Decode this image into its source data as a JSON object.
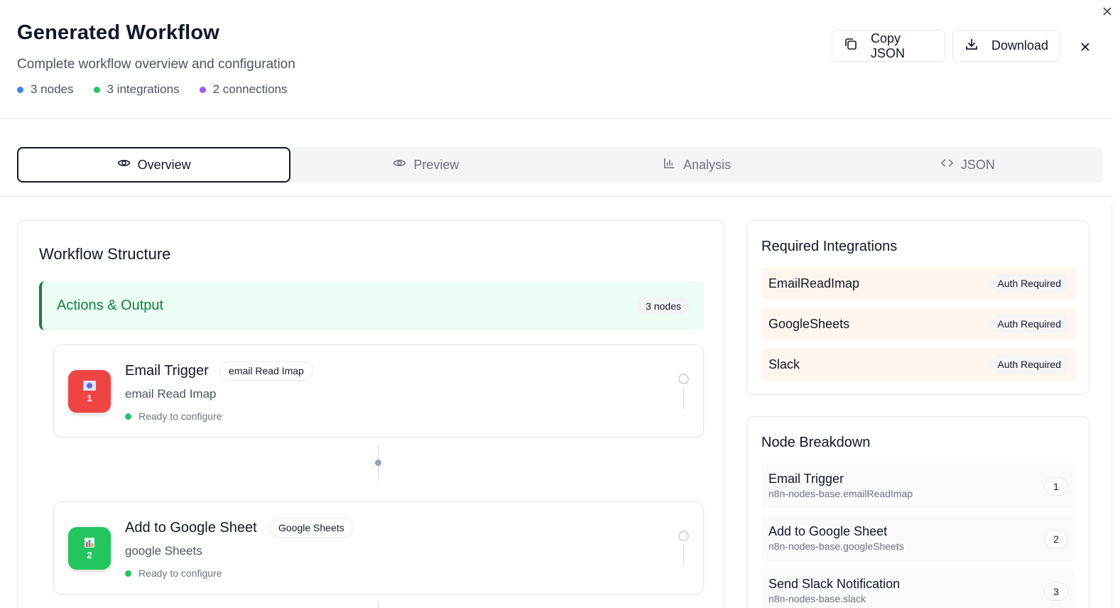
{
  "header": {
    "title": "Generated Workflow",
    "subtitle": "Complete workflow overview and configuration",
    "stats": [
      {
        "label": "3 nodes",
        "color": "#3b82f6"
      },
      {
        "label": "3 integrations",
        "color": "#22c55e"
      },
      {
        "label": "2 connections",
        "color": "#a855f7"
      }
    ],
    "copy_label": "Copy JSON",
    "download_label": "Download"
  },
  "tabs": [
    {
      "label": "Overview",
      "icon": "eye-icon",
      "active": true
    },
    {
      "label": "Preview",
      "icon": "eye-icon",
      "active": false
    },
    {
      "label": "Analysis",
      "icon": "bar-chart-icon",
      "active": false
    },
    {
      "label": "JSON",
      "icon": "code-icon",
      "active": false
    }
  ],
  "workflow": {
    "title": "Workflow Structure",
    "group": {
      "title": "Actions & Output",
      "count": "3 nodes"
    },
    "nodes": [
      {
        "number": "1",
        "title": "Email Trigger",
        "tag": "email Read Imap",
        "subtitle": "email Read Imap",
        "status": "Ready to configure",
        "icon": "email-icon",
        "color": "#ef4444"
      },
      {
        "number": "2",
        "title": "Add to Google Sheet",
        "tag": "Google Sheets",
        "subtitle": "google Sheets",
        "status": "Ready to configure",
        "icon": "sheets-icon",
        "color": "#22c55e"
      }
    ]
  },
  "integrations": {
    "title": "Required Integrations",
    "items": [
      {
        "name": "EmailReadImap",
        "badge": "Auth Required"
      },
      {
        "name": "GoogleSheets",
        "badge": "Auth Required"
      },
      {
        "name": "Slack",
        "badge": "Auth Required"
      }
    ]
  },
  "breakdown": {
    "title": "Node Breakdown",
    "items": [
      {
        "name": "Email Trigger",
        "type": "n8n-nodes-base.emailReadImap",
        "number": "1"
      },
      {
        "name": "Add to Google Sheet",
        "type": "n8n-nodes-base.googleSheets",
        "number": "2"
      },
      {
        "name": "Send Slack Notification",
        "type": "n8n-nodes-base.slack",
        "number": "3"
      }
    ]
  },
  "colors": {
    "status_dot": "#22c55e",
    "group_accent": "#15803d"
  }
}
